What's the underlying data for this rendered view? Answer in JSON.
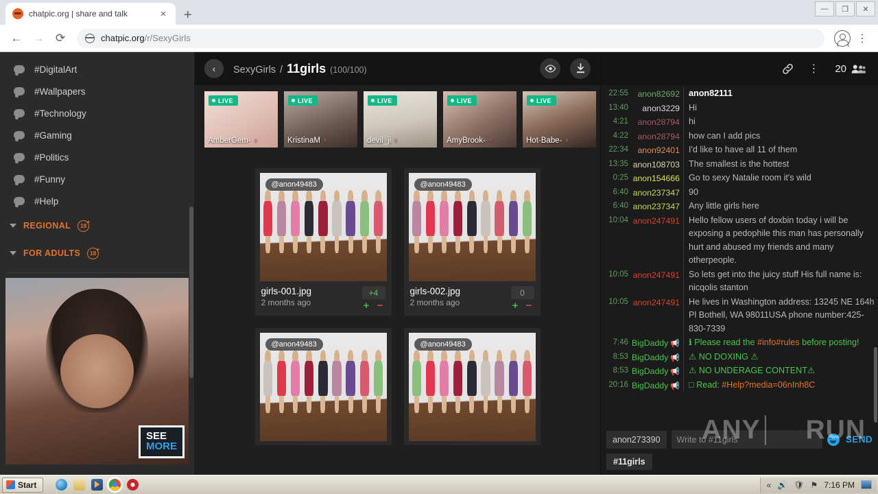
{
  "browser": {
    "tab_title": "chatpic.org | share and talk",
    "tab_close": "×",
    "new_tab": "+",
    "window_controls": {
      "minimize": "—",
      "restore": "❐",
      "close": "✕"
    },
    "back": "←",
    "forward": "→",
    "reload": "⟳",
    "url_main": "chatpic.org",
    "url_path": "/r/SexyGirls",
    "menu": "⋮"
  },
  "sidebar": {
    "items": [
      {
        "label": "#DigitalArt"
      },
      {
        "label": "#Wallpapers"
      },
      {
        "label": "#Technology"
      },
      {
        "label": "#Gaming"
      },
      {
        "label": "#Politics"
      },
      {
        "label": "#Funny"
      },
      {
        "label": "#Help"
      }
    ],
    "sections": [
      {
        "label": "REGIONAL",
        "badge": "18"
      },
      {
        "label": "FOR ADULTS",
        "badge": "18"
      }
    ],
    "ad": {
      "cta_line1": "SEE",
      "cta_line2": "MORE"
    }
  },
  "gallery": {
    "back_icon": "‹",
    "breadcrumb": {
      "parent": "SexyGirls",
      "separator": "/",
      "current": "11girls",
      "count": "(100/100)"
    },
    "actions": {
      "view_icon": "eye-icon",
      "download_icon": "download-icon"
    },
    "live_streams": [
      {
        "badge": "LIVE",
        "name": "AmberGem-",
        "gender": "♀"
      },
      {
        "badge": "LIVE",
        "name": "KristinaM",
        "gender": "♀"
      },
      {
        "badge": "LIVE",
        "name": "devil_ji",
        "gender": "♀"
      },
      {
        "badge": "LIVE",
        "name": "AmyBrook-",
        "gender": "♀"
      },
      {
        "badge": "LIVE",
        "name": "Hot-Babe-",
        "gender": "♀"
      }
    ],
    "cards": [
      {
        "author": "@anon49483",
        "filename": "girls-001.jpg",
        "age": "2 months ago",
        "score": "+4",
        "score_kind": "pos"
      },
      {
        "author": "@anon49483",
        "filename": "girls-002.jpg",
        "age": "2 months ago",
        "score": "0",
        "score_kind": "zero"
      },
      {
        "author": "@anon49483",
        "filename": "",
        "age": "",
        "score": "",
        "score_kind": "zero"
      },
      {
        "author": "@anon49483",
        "filename": "",
        "age": "",
        "score": "",
        "score_kind": "zero"
      }
    ],
    "vote_up": "+",
    "vote_down": "−"
  },
  "chat": {
    "header": {
      "link_icon": "link-icon",
      "menu_icon": "⋮",
      "user_count": "20",
      "users_icon": "users-icon"
    },
    "messages": [
      {
        "time": "22:55",
        "user": "anon82692",
        "user_color": "#6aa96a",
        "text": "anon82111",
        "style": "self"
      },
      {
        "time": "13:40",
        "user": "anon3229",
        "user_color": "#dadada",
        "text": "Hi",
        "style": ""
      },
      {
        "time": "4:21",
        "user": "anon28794",
        "user_color": "#a45a63",
        "text": "hi",
        "style": ""
      },
      {
        "time": "4:22",
        "user": "anon28794",
        "user_color": "#a45a63",
        "text": "how can I add pics",
        "style": ""
      },
      {
        "time": "22:34",
        "user": "anon92401",
        "user_color": "#e08a62",
        "text": "I'd like to have all 11 of them",
        "style": ""
      },
      {
        "time": "13:35",
        "user": "anon108703",
        "user_color": "#ded6b0",
        "text": "The smallest is the hottest",
        "style": ""
      },
      {
        "time": "0:25",
        "user": "anon154666",
        "user_color": "#d9e05a",
        "text": "Go to sexy Natalie room it's wild",
        "style": ""
      },
      {
        "time": "6:40",
        "user": "anon237347",
        "user_color": "#c8d95a",
        "text": "90",
        "style": ""
      },
      {
        "time": "6:40",
        "user": "anon237347",
        "user_color": "#c8d95a",
        "text": "Any little girls here",
        "style": ""
      },
      {
        "time": "10:04",
        "user": "anon247491",
        "user_color": "#d3452f",
        "text": "Hello fellow users of doxbin today i will be exposing a pedophile this man has personally hurt and abused my friends and many otherpeople.",
        "style": ""
      },
      {
        "time": "10:05",
        "user": "anon247491",
        "user_color": "#d3452f",
        "text": "So lets get into the juicy stuff  His full name is: nicqolis stanton",
        "style": ""
      },
      {
        "time": "10:05",
        "user": "anon247491",
        "user_color": "#d3452f",
        "text": "He lives in Washington address: 13245 NE 164h Pl Bothell, WA 98011USA phone number:425-830-7339",
        "style": ""
      },
      {
        "time": "7:46",
        "user": "BigDaddy",
        "user_color": "#4cc44c",
        "admin": true,
        "pre": "ℹ Please read the ",
        "hl": "#info#rules",
        "post": " before posting!",
        "style": "admin"
      },
      {
        "time": "8:53",
        "user": "BigDaddy",
        "user_color": "#4cc44c",
        "admin": true,
        "text": "⚠ NO DOXING ⚠",
        "style": "admin"
      },
      {
        "time": "8:53",
        "user": "BigDaddy",
        "user_color": "#4cc44c",
        "admin": true,
        "text": "⚠ NO UNDERAGE CONTENT⚠",
        "style": "admin"
      },
      {
        "time": "20:16",
        "user": "BigDaddy",
        "user_color": "#4cc44c",
        "admin": true,
        "pre": "□ Read: ",
        "hl": "#Help?media=06nInh8C",
        "post": "",
        "style": "admin"
      }
    ],
    "input": {
      "nickname": "anon273390",
      "placeholder": "Write to #11girls",
      "emoji_icon": "emoji-icon",
      "send_label": "SEND",
      "tag": "#11girls"
    }
  },
  "watermark": {
    "left": "ANY",
    "right": "RUN"
  },
  "taskbar": {
    "start_label": "Start",
    "quick_launch": [
      "internet-explorer-icon",
      "folder-icon",
      "media-player-icon",
      "chrome-icon",
      "opera-icon"
    ],
    "tray": {
      "chevron": "«",
      "volume": "🔊",
      "shield": "🛡",
      "network": "⚑",
      "time": "7:16 PM"
    }
  }
}
